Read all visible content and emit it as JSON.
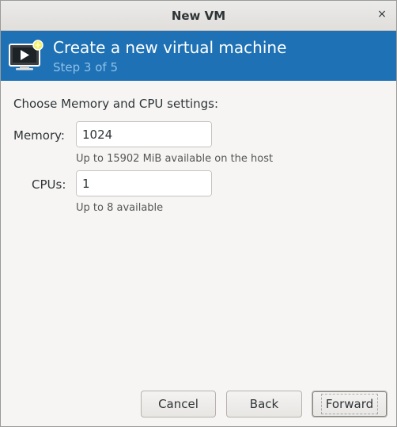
{
  "window": {
    "title": "New VM",
    "close_glyph": "×"
  },
  "banner": {
    "icon": "virtual-machine-screen-icon",
    "heading": "Create a new virtual machine",
    "step": "Step 3 of 5",
    "color": "#1e71b4"
  },
  "form": {
    "section_label": "Choose Memory and CPU settings:",
    "memory": {
      "label": "Memory:",
      "value": "1024",
      "decrement": "−",
      "increment": "+",
      "hint": "Up to 15902 MiB available on the host"
    },
    "cpus": {
      "label": "CPUs:",
      "value": "1",
      "decrement": "−",
      "increment": "+",
      "decrement_disabled": true,
      "hint": "Up to 8 available"
    }
  },
  "actions": {
    "cancel": "Cancel",
    "back": "Back",
    "forward": "Forward"
  }
}
